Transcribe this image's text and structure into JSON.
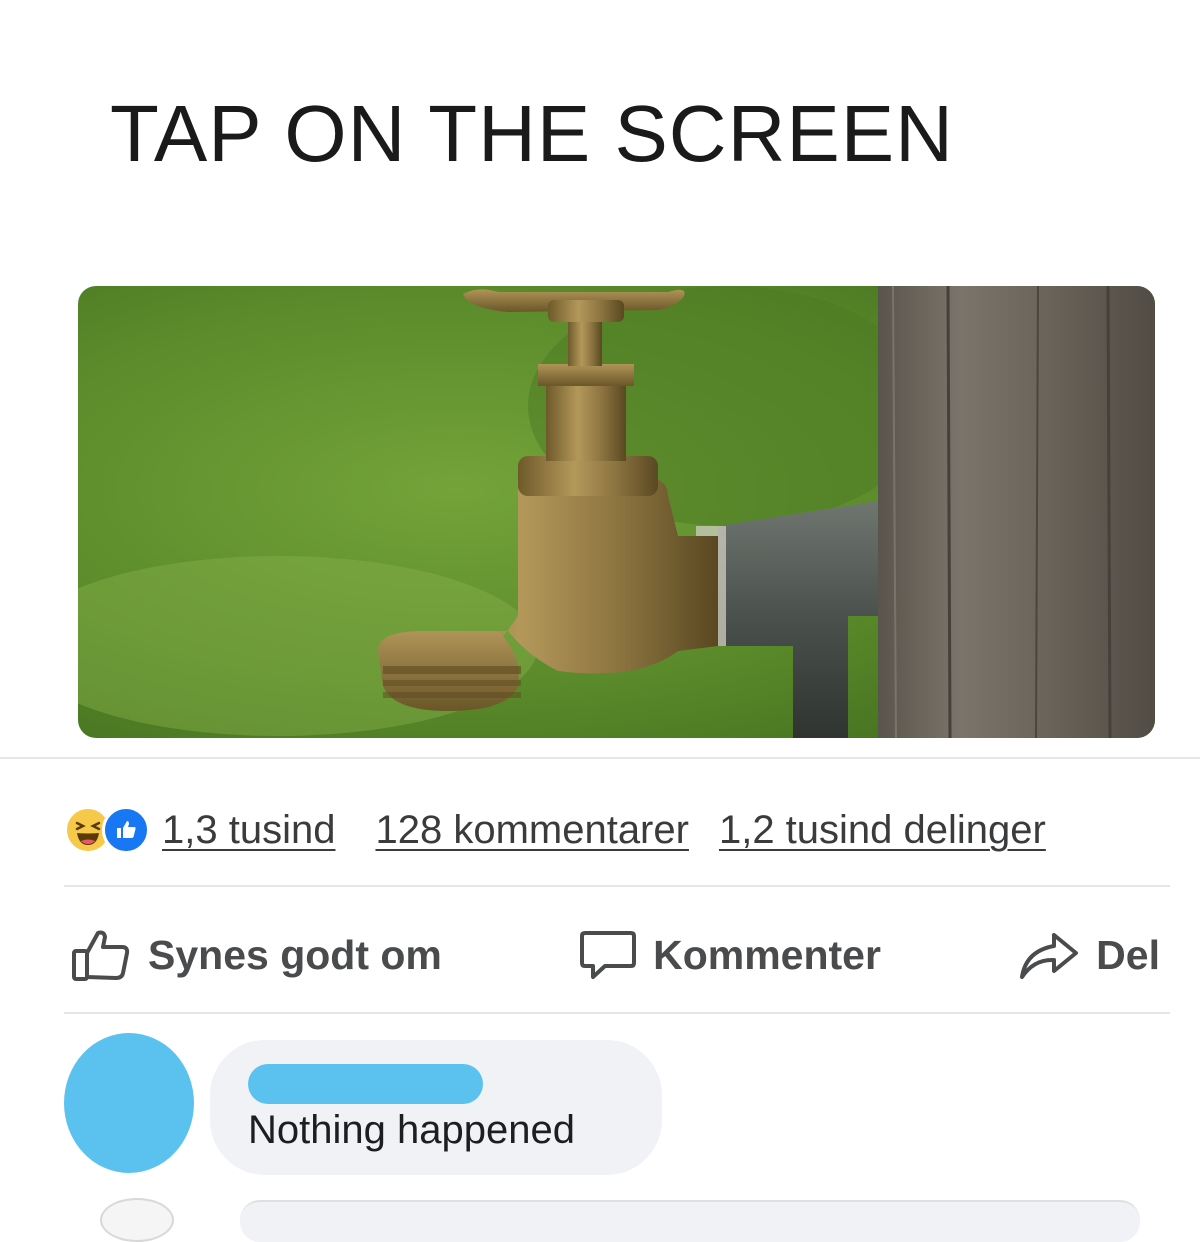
{
  "post": {
    "text": "TAP ON THE SCREEN",
    "image": {
      "subject": "brass-garden-faucet-on-wooden-post"
    }
  },
  "stats": {
    "reaction_icons": [
      "haha-reaction-icon",
      "like-reaction-icon"
    ],
    "reactions_count": "1,3 tusind",
    "comments_count": "128 kommentarer",
    "shares_count": "1,2 tusind delinger"
  },
  "actions": {
    "like_label": "Synes godt om",
    "comment_label": "Kommenter",
    "share_label": "Del",
    "icons": {
      "like": "thumbs-up-icon",
      "comment": "speech-bubble-icon",
      "share": "share-arrow-icon"
    }
  },
  "comment": {
    "text": "Nothing happened"
  },
  "colors": {
    "like_blue": "#1877f2",
    "haha_yellow": "#f7c94a",
    "redaction_blue": "#5bc2ef",
    "bubble_gray": "#f0f2f5"
  }
}
